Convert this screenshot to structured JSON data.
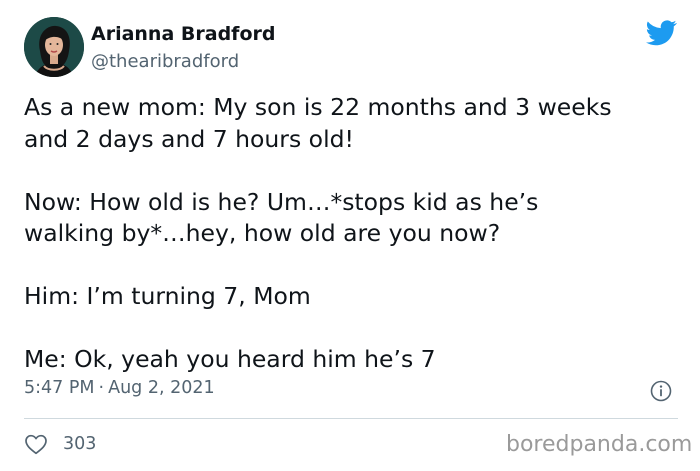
{
  "author": {
    "display_name": "Arianna Bradford",
    "handle": "@thearibradford"
  },
  "tweet": {
    "paragraphs": [
      "As a new mom: My son is 22 months and 3 weeks\nand 2 days and 7 hours old!",
      "Now: How old is he? Um…*stops kid as he’s\nwalking by*…hey, how old are you now?",
      "Him: I’m turning 7, Mom",
      "Me: Ok, yeah you heard him he’s 7"
    ],
    "time": "5:47 PM",
    "separator": "·",
    "date": "Aug 2, 2021",
    "likes": "303"
  },
  "icons": {
    "brand": "twitter-bird-icon",
    "info": "info-icon",
    "like": "heart-icon"
  },
  "colors": {
    "brand": "#1d9bf0",
    "secondary_text": "#536471",
    "primary_text": "#0f1419"
  },
  "watermark": "boredpanda.com"
}
